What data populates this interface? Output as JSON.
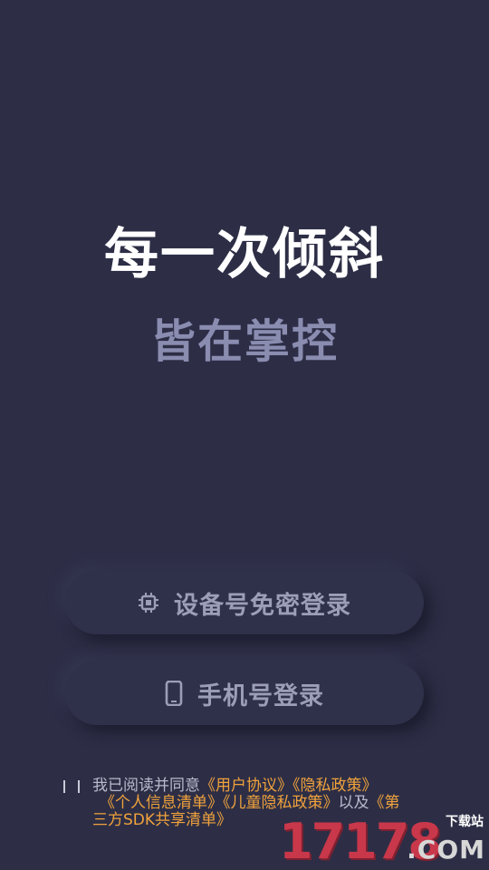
{
  "hero": {
    "title": "每一次倾斜",
    "subtitle": "皆在掌控"
  },
  "buttons": {
    "device_login": {
      "label": "设备号免密登录",
      "icon": "chip-icon"
    },
    "phone_login": {
      "label": "手机号登录",
      "icon": "smartphone-icon"
    }
  },
  "agreement": {
    "prefix": "我已阅读并同意",
    "user_agreement": "《用户协议》",
    "privacy_policy": "《隐私政策》",
    "personal_info_list": "《个人信息清单》",
    "child_privacy_policy": "《儿童隐私政策》",
    "connector": "以及",
    "third_party_sdk_list_part1": "《第",
    "third_party_sdk_list_part2": "三方SDK共享清单》",
    "checked": false
  },
  "watermark": {
    "number": "17178",
    "download_text": "下载站",
    "domain": ".COM"
  },
  "colors": {
    "background": "#2d2e46",
    "title": "#ffffff",
    "subtitle": "#8a8cb0",
    "button_text": "#9c9eb8",
    "link": "#f0a23c"
  }
}
